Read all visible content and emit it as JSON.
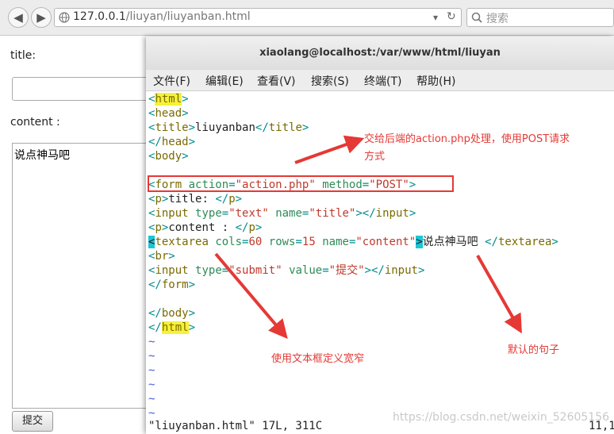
{
  "browser": {
    "url_host": "127.0.0.1",
    "url_path": "/liuyan/liuyanban.html",
    "search_placeholder": "搜索"
  },
  "form": {
    "title_label": "title:",
    "content_label": "content :",
    "textarea_value": "说点神马吧",
    "submit_label": "提交"
  },
  "terminal": {
    "title": "xiaolang@localhost:/var/www/html/liuyan",
    "menu": [
      "文件(F)",
      "编辑(E)",
      "查看(V)",
      "搜索(S)",
      "终端(T)",
      "帮助(H)"
    ],
    "code": {
      "form_attr_value": "\"action.php\"",
      "method_value": "\"POST\"",
      "title_text": "liuyanban",
      "p_title": "title: ",
      "p_content": "content : ",
      "textarea_default": "说点神马吧 ",
      "submit_value": "\"提交\""
    },
    "status_file": "\"liuyanban.html\" 17L, 311C",
    "status_pos": "11,1"
  },
  "annotations": {
    "action_note_line1": "交给后端的action.php处理，使用POST请求",
    "action_note_line2": "方式",
    "textarea_note": "使用文本框定义宽窄",
    "default_note": "默认的句子"
  },
  "watermark": "https://blog.csdn.net/weixin_52605156",
  "colors": {
    "annotation": "#e53935",
    "highlight": "#f6f13a",
    "cursor": "#19c6d6"
  }
}
